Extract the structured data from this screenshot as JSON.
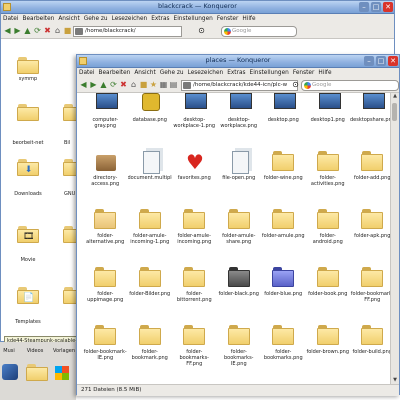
{
  "back_window": {
    "title": "blackcrack — Konqueror",
    "menu": [
      "Datei",
      "Bearbeiten",
      "Ansicht",
      "Gehe zu",
      "Lesezeichen",
      "Extras",
      "Einstellungen",
      "Fenster",
      "Hilfe"
    ],
    "url": "/home/blackcrack/",
    "search_placeholder": "Google",
    "items": [
      {
        "label": "symmp",
        "emblem": ""
      },
      {
        "label": "beorbeit-net",
        "emblem": ""
      },
      {
        "label": "Downloads",
        "emblem": "⬇"
      },
      {
        "label": "Movie",
        "emblem": "🎞"
      },
      {
        "label": "Templates",
        "emblem": "📄"
      }
    ],
    "right_col_labels": [
      "Bil",
      "GNU"
    ],
    "tooltip": "kde44-Steampunk-scalable-black",
    "bottom_labels": [
      "Musi",
      "Videos",
      "Vorlagen"
    ]
  },
  "front_window": {
    "title": "places — Konqueror",
    "menu": [
      "Datei",
      "Bearbeiten",
      "Ansicht",
      "Gehe zu",
      "Lesezeichen",
      "Extras",
      "Einstellungen",
      "Fenster",
      "Hilfe"
    ],
    "url": "/home/blackcrack/kde44-icn/plc-w",
    "search_placeholder": "Google",
    "status": "271 Dateien (8.5 MiB)",
    "rows": [
      [
        "computer-gray.png",
        "database.png",
        "desktop-workplace-1.png",
        "desktop-workplace.png",
        "desktop.png",
        "desktop1.png",
        "desktopshare.png"
      ],
      [
        "directory-access.png",
        "document.multiple.png",
        "favorites.png",
        "file-open.png",
        "folder-wine.png",
        "folder-activities.png",
        "folder-add.png"
      ],
      [
        "folder-alternative.png",
        "folder-amule-incoming-1.png",
        "folder-amule-incoming.png",
        "folder-amule-share.png",
        "folder-amule.png",
        "folder-android.png",
        "folder-apk.png"
      ],
      [
        "folder-uppimage.png",
        "folder-Bilder.png",
        "folder-bittorrent.png",
        "folder-black.png",
        "folder-blue.png",
        "folder-book.png",
        "folder-bookmark-FF.png"
      ],
      [
        "folder-bookmark-IE.png",
        "folder-bookmark.png",
        "folder-bookmarks-FF.png",
        "folder-bookmarks-IE.png",
        "folder-bookmarks.png",
        "folder-brown.png",
        "folder-build.png"
      ]
    ]
  },
  "icons": {
    "close": "✕",
    "minimize": "–",
    "maximize": "□"
  }
}
